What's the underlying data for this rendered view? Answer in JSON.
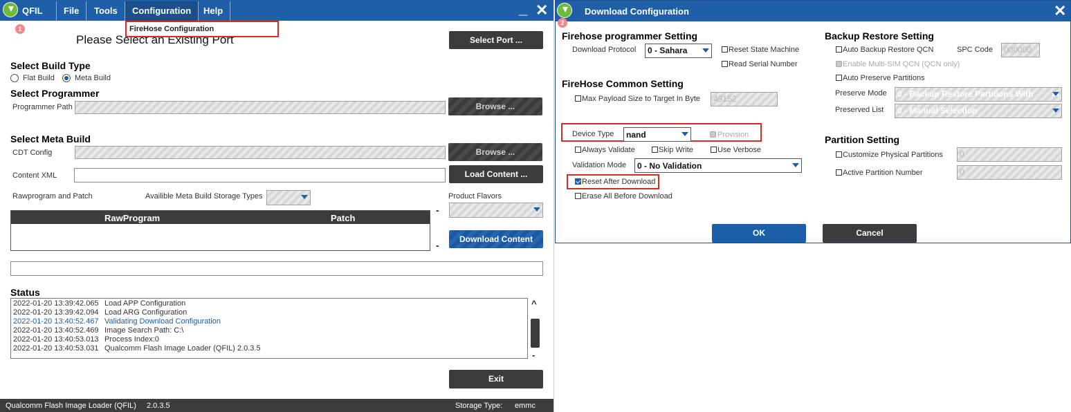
{
  "qfil": {
    "title": "QFIL",
    "menu": [
      "File",
      "Tools",
      "Configuration",
      "Help"
    ],
    "badge": "1",
    "dropdown_item": "FireHose Configuration",
    "heading": "Please Select an Existing Port",
    "select_port_button": "Select Port ...",
    "build_type": {
      "title": "Select Build Type",
      "options": [
        "Flat Build",
        "Meta Build"
      ],
      "selected": "Meta Build"
    },
    "programmer": {
      "title": "Select Programmer",
      "path_label": "Programmer Path",
      "browse_button": "Browse ..."
    },
    "meta_build": {
      "title": "Select Meta Build",
      "cdt_label": "CDT Config",
      "browse_button": "Browse ...",
      "content_xml_label": "Content XML",
      "load_content_button": "Load Content ...",
      "rawprogram_label": "Rawprogram and Patch",
      "storage_types_label": "Availible Meta Build Storage Types",
      "product_flavors_label": "Product Flavors",
      "table_headers": [
        "RawProgram",
        "Patch"
      ],
      "minus": "-",
      "download_content_button": "Download Content"
    },
    "status": {
      "title": "Status",
      "lines": [
        {
          "time": "2022-01-20 13:39:42.065",
          "msg": "Load APP Configuration"
        },
        {
          "time": "2022-01-20 13:39:42.094",
          "msg": "Load ARG Configuration"
        },
        {
          "time": "2022-01-20 13:40:52.467",
          "msg": "Validating Download Configuration"
        },
        {
          "time": "2022-01-20 13:40:52.469",
          "msg": "Image Search Path: C:\\"
        },
        {
          "time": "2022-01-20 13:40:53.013",
          "msg": "Process Index:0"
        },
        {
          "time": "2022-01-20 13:40:53.031",
          "msg": "Qualcomm Flash Image Loader (QFIL) 2.0.3.5"
        }
      ],
      "scroll_up": "^",
      "scroll_down": "-"
    },
    "exit_button": "Exit",
    "footer": {
      "app": "Qualcomm Flash Image Loader (QFIL)",
      "version": "2.0.3.5",
      "storage_label": "Storage Type:",
      "storage_value": "emmc"
    }
  },
  "dialog": {
    "title": "Download Configuration",
    "badge": "2",
    "firehose_programmer": {
      "title": "Firehose programmer Setting",
      "protocol_label": "Download Protocol",
      "protocol_value": "0 - Sahara",
      "reset_state_machine": "Reset State Machine",
      "read_serial_number": "Read Serial Number"
    },
    "firehose_common": {
      "title": "FireHose Common Setting",
      "max_payload_label": "Max Payload Size to Target In Byte",
      "max_payload_value": "49152",
      "device_type_label": "Device Type",
      "device_type_value": "nand",
      "provision": "Provision",
      "always_validate": "Always Validate",
      "skip_write": "Skip Write",
      "use_verbose": "Use Verbose",
      "validation_mode_label": "Validation Mode",
      "validation_mode_value": "0 - No Validation",
      "reset_after_download": "Reset After Download",
      "erase_all": "Erase All Before Download"
    },
    "backup_restore": {
      "title": "Backup Restore Setting",
      "auto_backup": "Auto Backup Restore QCN",
      "spc_code_label": "SPC Code",
      "spc_code_value": "000000",
      "enable_multi_sim": "Enable Multi-SIM QCN (QCN only)",
      "auto_preserve": "Auto Preserve Partitions",
      "preserve_mode_label": "Preserve Mode",
      "preserve_mode_value": "0 - Backup Restore Partitions With",
      "preserved_list_label": "Preserved List",
      "preserved_list_value": "0 - Manual Selection"
    },
    "partition": {
      "title": "Partition Setting",
      "customize_physical": "Customize Physical Partitions",
      "customize_value": "0",
      "active_partition": "Active Partition Number",
      "active_value": "0"
    },
    "ok_button": "OK",
    "cancel_button": "Cancel"
  },
  "colors": {
    "titlebar": "#1f5fa8",
    "accent": "#1a5fa8",
    "dark_button": "#3c3c3c",
    "highlight_box": "#d62a2a"
  }
}
